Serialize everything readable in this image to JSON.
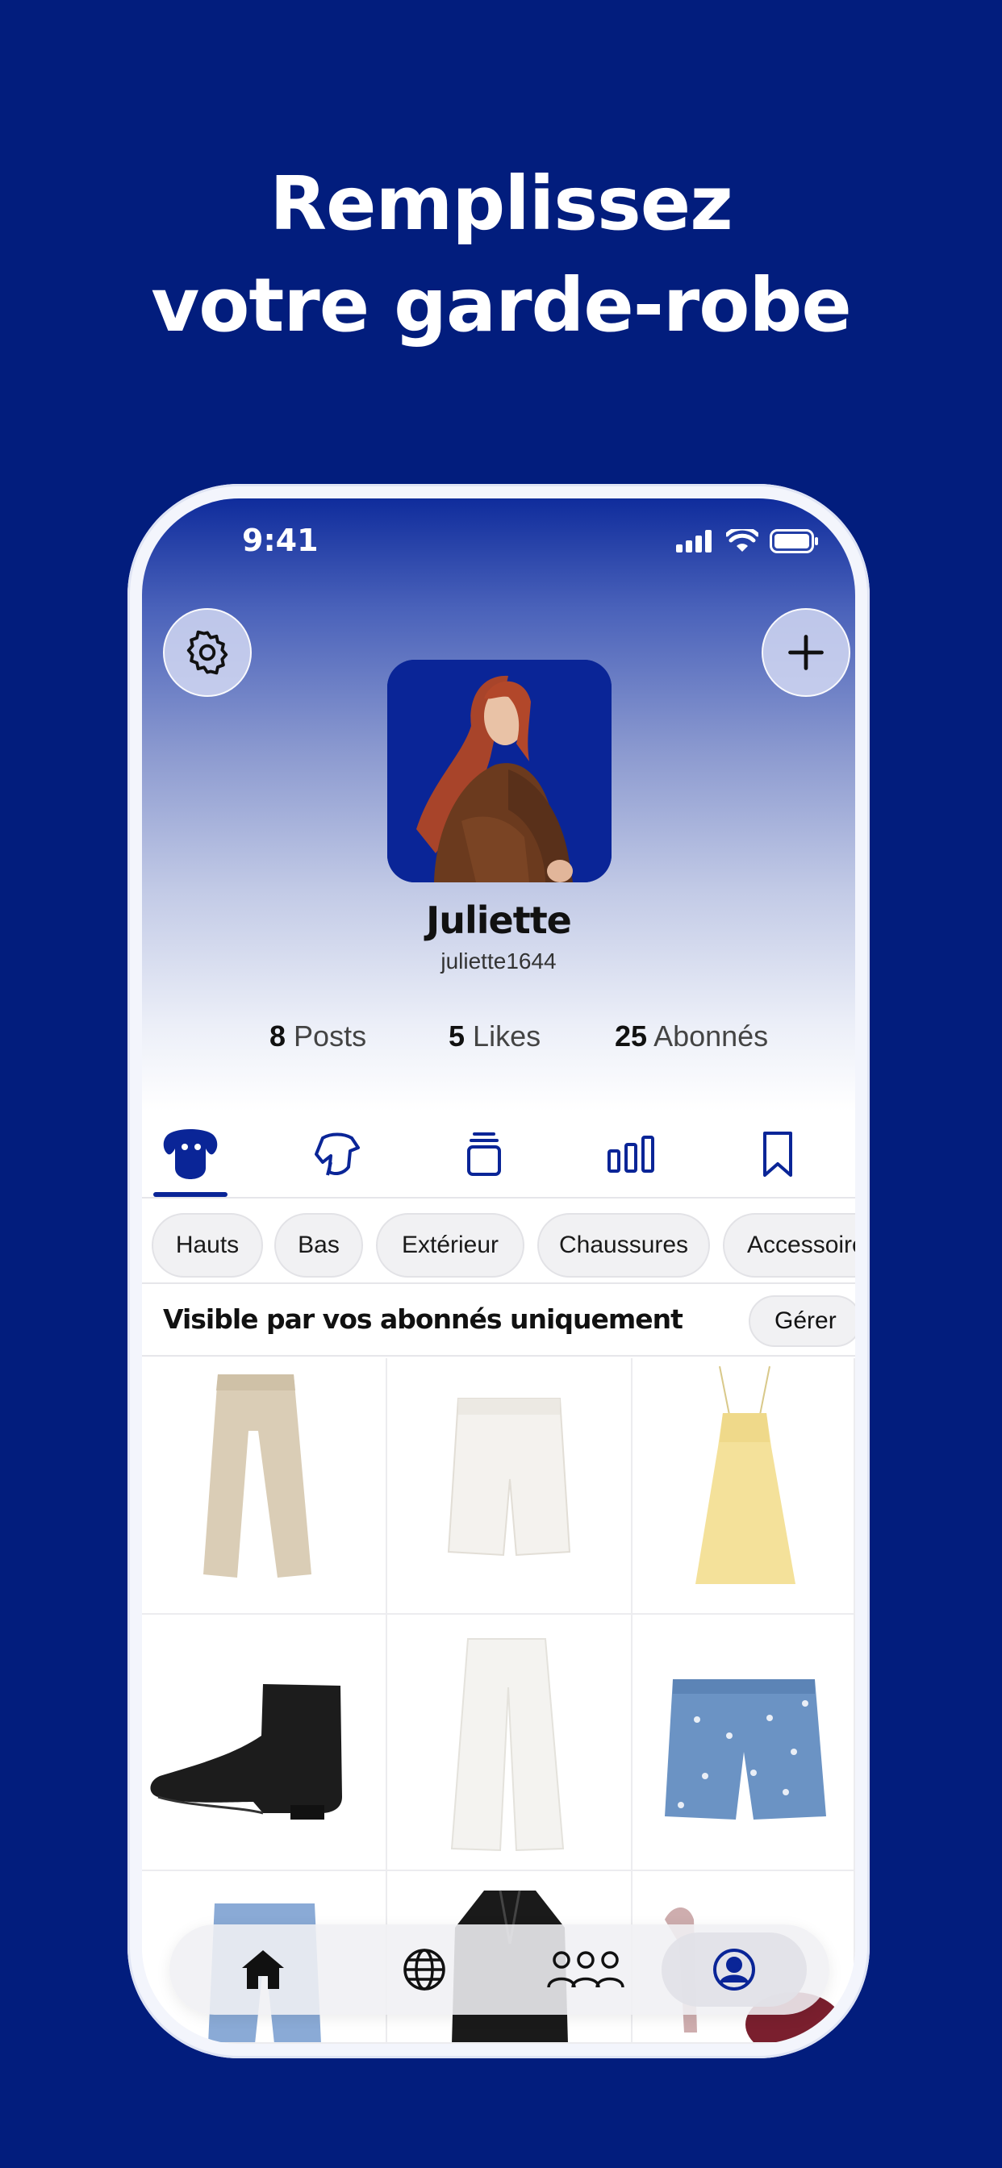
{
  "headline": {
    "line1": "Remplissez",
    "line2": "votre garde-robe"
  },
  "status_bar": {
    "time": "9:41"
  },
  "profile": {
    "name": "Juliette",
    "handle": "juliette1644",
    "stats": {
      "posts_count": "8",
      "posts_label": "Posts",
      "likes_count": "5",
      "likes_label": "Likes",
      "followers_count": "25",
      "followers_label": "Abonnés"
    }
  },
  "icons": {
    "settings": "gear-icon",
    "add": "plus-icon",
    "tabs": [
      "wardrobe-icon",
      "outfit-icon",
      "stack-icon",
      "stats-icon",
      "bookmark-icon"
    ],
    "bottom_nav": [
      "home-icon",
      "globe-icon",
      "people-icon",
      "profile-icon"
    ]
  },
  "categories": [
    "Hauts",
    "Bas",
    "Extérieur",
    "Chaussures",
    "Accessoires"
  ],
  "visibility": {
    "text": "Visible par vos abonnés uniquement",
    "manage_label": "Gérer"
  },
  "wardrobe_items": [
    "beige-trousers",
    "white-shorts",
    "yellow-dress",
    "black-ankle-boot",
    "white-trousers",
    "denim-shorts",
    "blue-jeans",
    "black-coat",
    "burgundy-item"
  ],
  "colors": {
    "brand": "#021d7d",
    "accent": "#0a2597",
    "white": "#ffffff"
  }
}
